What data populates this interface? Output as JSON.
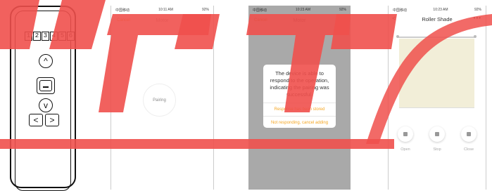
{
  "remote": {
    "channels": [
      "1",
      "2",
      "3",
      "4",
      "5",
      "6"
    ],
    "up_symbol": "^",
    "down_symbol": "v",
    "left_symbol": "<",
    "right_symbol": ">"
  },
  "pairing_screen": {
    "status_left": "中国移动",
    "status_time": "10:11 AM",
    "status_right": "92%",
    "back_label": "Cancel",
    "title": "Motor",
    "pairing_label": "Pairing"
  },
  "dialog_screen": {
    "status_left": "中国移动",
    "status_time": "10:23 AM",
    "status_right": "92%",
    "back_label": "Cancel",
    "title": "Motor",
    "message": "The device is able to respond to the operation, indicating the pairing was successful.",
    "option_stored": "Response has been stored",
    "option_cancel": "Not responding, cancel adding"
  },
  "shade_screen": {
    "status_left": "中国移动",
    "status_time": "10:23 AM",
    "status_right": "92%",
    "back_symbol": "<",
    "title": "Roller Shade",
    "more_symbol": "•••",
    "controls": [
      {
        "label": "Open"
      },
      {
        "label": "Stop"
      },
      {
        "label": "Close"
      }
    ]
  },
  "colors": {
    "overlay_red": "#f0504c",
    "accent_orange": "#f5a623",
    "shade_fabric": "#f2eed8"
  }
}
